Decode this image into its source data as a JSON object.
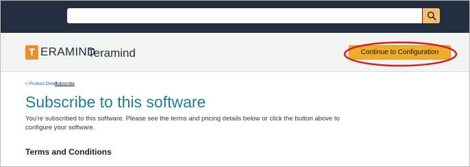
{
  "search": {
    "placeholder": "",
    "icon": "search-icon"
  },
  "header": {
    "logo_letter": "T",
    "logo_word": "ERAMIND",
    "product_name": "Teramind",
    "continue_button": "Continue to Configuration"
  },
  "breadcrumb": {
    "back": "< Product Detail",
    "current": "Subscribe"
  },
  "main": {
    "title": "Subscribe to this software",
    "description": "You're subscribed to this software. Please see the terms and pricing details below or click the button above to configure your software.",
    "section_title": "Terms and Conditions"
  },
  "colors": {
    "topbar": "#232f3e",
    "search_button": "#febd69",
    "cta": "#f0ad29",
    "title": "#1a7f92",
    "link": "#0066c0",
    "highlight": "#e0141e"
  }
}
